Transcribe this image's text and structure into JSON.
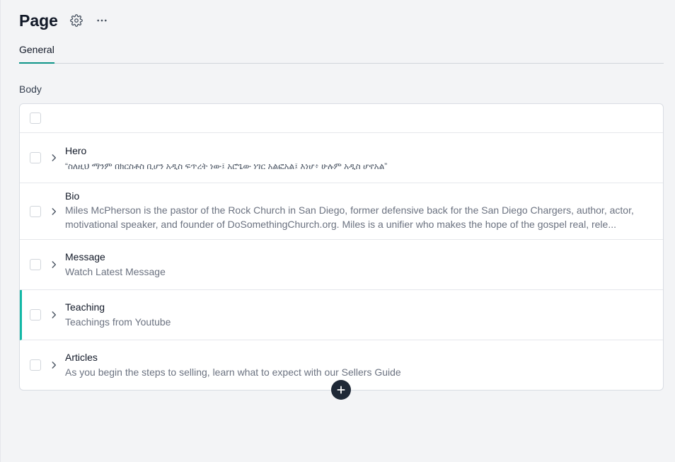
{
  "header": {
    "title": "Page"
  },
  "tabs": [
    {
      "label": "General",
      "active": true
    }
  ],
  "body": {
    "label": "Body",
    "items": [
      {
        "title": "Hero",
        "subtitle": "“ስለዚህ ማንም በክርስቶስ ቢሆን አዲስ ፍጥረት ነው፤ አሮጌው ነገር አልፎአል፤ እነሆ፥ ሁሉም አዲስ ሆኖአል”"
      },
      {
        "title": "Bio",
        "subtitle_line1": "Miles McPherson is the pastor of the Rock Church in San Diego, former defensive back for the San Diego Chargers, author, actor,",
        "subtitle_line2": "motivational speaker, and founder of DoSomethingChurch.org. Miles is a unifier who makes the hope of the gospel real, rele..."
      },
      {
        "title": "Message",
        "subtitle": "Watch Latest Message"
      },
      {
        "title": "Teaching",
        "subtitle": "Teachings from Youtube"
      },
      {
        "title": "Articles",
        "subtitle": "As you begin the steps to selling, learn what to expect with our Sellers Guide"
      }
    ]
  },
  "colors": {
    "accent": "#0d9488",
    "active_row_border": "#14b8a6",
    "add_button": "#1f2937"
  },
  "icons": {
    "settings": "gear-icon",
    "more": "ellipsis-icon",
    "expand": "chevron-right-icon",
    "add": "plus-icon"
  }
}
